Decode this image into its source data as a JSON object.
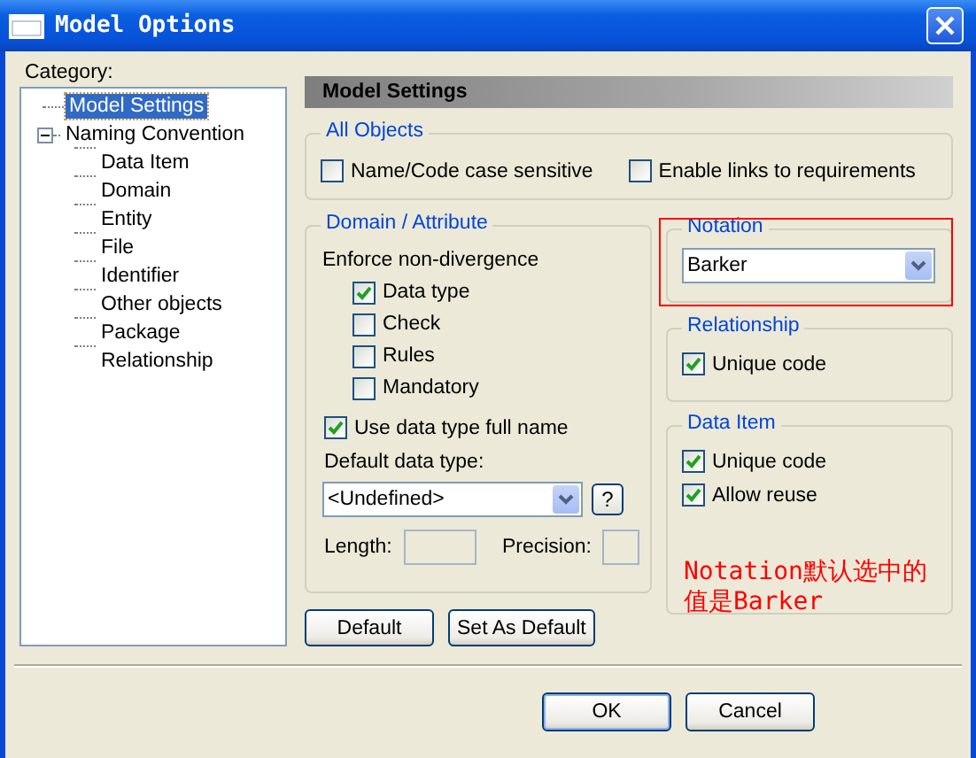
{
  "window": {
    "title": "Model Options"
  },
  "category_label": "Category:",
  "tree": [
    {
      "label": "Model Settings",
      "selected": true
    },
    {
      "label": "Naming Convention",
      "selected": false,
      "expanded": true,
      "children": [
        {
          "label": "Data Item",
          "selected": false
        },
        {
          "label": "Domain",
          "selected": false
        },
        {
          "label": "Entity",
          "selected": false
        },
        {
          "label": "File",
          "selected": false
        },
        {
          "label": "Identifier",
          "selected": false
        },
        {
          "label": "Other objects",
          "selected": false
        },
        {
          "label": "Package",
          "selected": false
        },
        {
          "label": "Relationship",
          "selected": false
        }
      ]
    }
  ],
  "header": "Model Settings",
  "all_objects": {
    "title": "All Objects",
    "checkboxes": [
      {
        "label": "Name/Code case sensitive",
        "checked": false
      },
      {
        "label": "Enable links to requirements",
        "checked": false
      }
    ]
  },
  "domain_attribute": {
    "title": "Domain / Attribute",
    "subtitle": "Enforce non-divergence",
    "checkboxes": [
      {
        "label": "Data type",
        "checked": true
      },
      {
        "label": "Check",
        "checked": false
      },
      {
        "label": "Rules",
        "checked": false
      },
      {
        "label": "Mandatory",
        "checked": false
      }
    ],
    "full_name": {
      "label": "Use data type full name",
      "checked": true
    },
    "default_type_label": "Default data type:",
    "default_type_value": "<Undefined>",
    "help_button": "?",
    "length_label": "Length:",
    "precision_label": "Precision:"
  },
  "notation": {
    "title": "Notation",
    "value": "Barker"
  },
  "relationship": {
    "title": "Relationship",
    "checkboxes": [
      {
        "label": "Unique code",
        "checked": true
      }
    ]
  },
  "data_item": {
    "title": "Data Item",
    "checkboxes": [
      {
        "label": "Unique code",
        "checked": true
      },
      {
        "label": "Allow reuse",
        "checked": true
      }
    ]
  },
  "annotation": "Notation默认选中的值是Barker",
  "panel_buttons": [
    "Default",
    "Set As Default"
  ],
  "dialog_buttons": [
    "OK",
    "Cancel"
  ]
}
